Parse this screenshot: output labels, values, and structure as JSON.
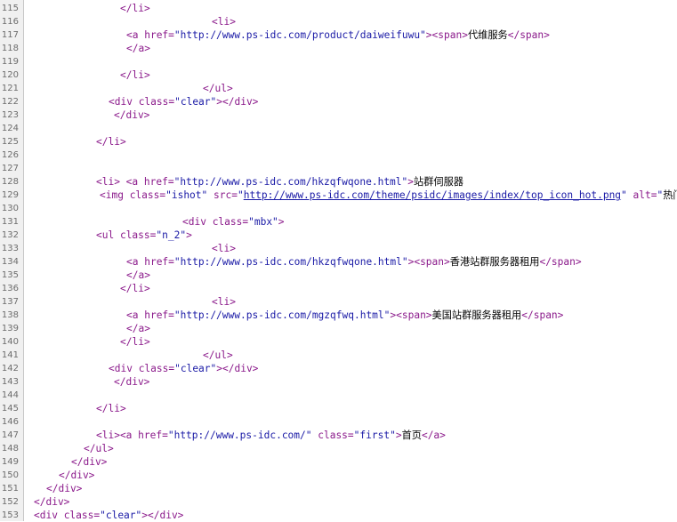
{
  "lines": [
    {
      "num": "115",
      "segs": [
        {
          "t": "t",
          "s": "</li>"
        }
      ]
    },
    {
      "num": "116",
      "segs": [
        {
          "t": "t",
          "s": "<li>"
        }
      ]
    },
    {
      "num": "117",
      "segs": [
        {
          "t": "t",
          "s": "<a "
        },
        {
          "t": "a",
          "s": "href="
        },
        {
          "t": "v",
          "s": "\"http://www.ps-idc.com/product/daiweifuwu\""
        },
        {
          "t": "t",
          "s": "><span>"
        },
        {
          "t": "c",
          "s": "代维服务"
        },
        {
          "t": "t",
          "s": "</span>"
        }
      ]
    },
    {
      "num": "118",
      "segs": [
        {
          "t": "t",
          "s": "</a>"
        }
      ]
    },
    {
      "num": "119",
      "segs": []
    },
    {
      "num": "120",
      "segs": [
        {
          "t": "t",
          "s": "</li>"
        }
      ]
    },
    {
      "num": "121",
      "segs": [
        {
          "t": "t",
          "s": "</ul>"
        }
      ]
    },
    {
      "num": "122",
      "segs": [
        {
          "t": "t",
          "s": "<div "
        },
        {
          "t": "a",
          "s": "class="
        },
        {
          "t": "v",
          "s": "\"clear\""
        },
        {
          "t": "t",
          "s": "></div>"
        }
      ]
    },
    {
      "num": "123",
      "segs": [
        {
          "t": "t",
          "s": "</div>"
        }
      ]
    },
    {
      "num": "124",
      "segs": []
    },
    {
      "num": "125",
      "segs": [
        {
          "t": "t",
          "s": "</li>"
        }
      ]
    },
    {
      "num": "126",
      "segs": []
    },
    {
      "num": "127",
      "segs": []
    },
    {
      "num": "128",
      "segs": [
        {
          "t": "t",
          "s": "<li> <a "
        },
        {
          "t": "a",
          "s": "href="
        },
        {
          "t": "v",
          "s": "\"http://www.ps-idc.com/hkzqfwqone.html\""
        },
        {
          "t": "t",
          "s": ">"
        },
        {
          "t": "c",
          "s": "站群伺服器"
        }
      ]
    },
    {
      "num": "129",
      "segs": [
        {
          "t": "t",
          "s": "<img "
        },
        {
          "t": "a",
          "s": "class="
        },
        {
          "t": "v",
          "s": "\"ishot\" "
        },
        {
          "t": "a",
          "s": "src="
        },
        {
          "t": "v",
          "s": "\""
        },
        {
          "t": "u",
          "s": "http://www.ps-idc.com/theme/psidc/images/index/top_icon_hot.png"
        },
        {
          "t": "v",
          "s": "\" "
        },
        {
          "t": "a",
          "s": "alt="
        },
        {
          "t": "v",
          "s": "\""
        },
        {
          "t": "c",
          "s": "热门"
        },
        {
          "t": "v",
          "s": "\""
        }
      ]
    },
    {
      "num": "130",
      "segs": []
    },
    {
      "num": "131",
      "segs": [
        {
          "t": "t",
          "s": "<div "
        },
        {
          "t": "a",
          "s": "class="
        },
        {
          "t": "v",
          "s": "\"mbx\""
        },
        {
          "t": "t",
          "s": ">"
        }
      ]
    },
    {
      "num": "132",
      "segs": [
        {
          "t": "t",
          "s": "<ul "
        },
        {
          "t": "a",
          "s": "class="
        },
        {
          "t": "v",
          "s": "\"n_2\""
        },
        {
          "t": "t",
          "s": ">"
        }
      ]
    },
    {
      "num": "133",
      "segs": [
        {
          "t": "t",
          "s": "<li>"
        }
      ]
    },
    {
      "num": "134",
      "segs": [
        {
          "t": "t",
          "s": "<a "
        },
        {
          "t": "a",
          "s": "href="
        },
        {
          "t": "v",
          "s": "\"http://www.ps-idc.com/hkzqfwqone.html\""
        },
        {
          "t": "t",
          "s": "><span>"
        },
        {
          "t": "c",
          "s": "香港站群服务器租用"
        },
        {
          "t": "t",
          "s": "</span>"
        }
      ]
    },
    {
      "num": "135",
      "segs": [
        {
          "t": "t",
          "s": "</a>"
        }
      ]
    },
    {
      "num": "136",
      "segs": [
        {
          "t": "t",
          "s": "</li>"
        }
      ]
    },
    {
      "num": "137",
      "segs": [
        {
          "t": "t",
          "s": "<li>"
        }
      ]
    },
    {
      "num": "138",
      "segs": [
        {
          "t": "t",
          "s": "<a "
        },
        {
          "t": "a",
          "s": "href="
        },
        {
          "t": "v",
          "s": "\"http://www.ps-idc.com/mgzqfwq.html\""
        },
        {
          "t": "t",
          "s": "><span>"
        },
        {
          "t": "c",
          "s": "美国站群服务器租用"
        },
        {
          "t": "t",
          "s": "</span>"
        }
      ]
    },
    {
      "num": "139",
      "segs": [
        {
          "t": "t",
          "s": "</a>"
        }
      ]
    },
    {
      "num": "140",
      "segs": [
        {
          "t": "t",
          "s": "</li>"
        }
      ]
    },
    {
      "num": "141",
      "segs": [
        {
          "t": "t",
          "s": "</ul>"
        }
      ]
    },
    {
      "num": "142",
      "segs": [
        {
          "t": "t",
          "s": "<div "
        },
        {
          "t": "a",
          "s": "class="
        },
        {
          "t": "v",
          "s": "\"clear\""
        },
        {
          "t": "t",
          "s": "></div>"
        }
      ]
    },
    {
      "num": "143",
      "segs": [
        {
          "t": "t",
          "s": "</div>"
        }
      ]
    },
    {
      "num": "144",
      "segs": []
    },
    {
      "num": "145",
      "segs": [
        {
          "t": "t",
          "s": "</li>"
        }
      ]
    },
    {
      "num": "146",
      "segs": []
    },
    {
      "num": "147",
      "segs": [
        {
          "t": "t",
          "s": "<li><a "
        },
        {
          "t": "a",
          "s": "href="
        },
        {
          "t": "v",
          "s": "\"http://www.ps-idc.com/\" "
        },
        {
          "t": "a",
          "s": "class="
        },
        {
          "t": "v",
          "s": "\"first\""
        },
        {
          "t": "t",
          "s": ">"
        },
        {
          "t": "c",
          "s": "首页"
        },
        {
          "t": "t",
          "s": "</a>"
        }
      ]
    },
    {
      "num": "148",
      "segs": [
        {
          "t": "t",
          "s": "</ul>"
        }
      ]
    },
    {
      "num": "149",
      "segs": [
        {
          "t": "t",
          "s": "</div>"
        }
      ]
    },
    {
      "num": "150",
      "segs": [
        {
          "t": "t",
          "s": "</div>"
        }
      ]
    },
    {
      "num": "151",
      "segs": [
        {
          "t": "t",
          "s": "</div>"
        }
      ]
    },
    {
      "num": "152",
      "segs": [
        {
          "t": "t",
          "s": "</div>"
        }
      ]
    },
    {
      "num": "153",
      "segs": [
        {
          "t": "t",
          "s": "<div "
        },
        {
          "t": "a",
          "s": "class="
        },
        {
          "t": "v",
          "s": "\"clear\""
        },
        {
          "t": "t",
          "s": "></div>"
        }
      ]
    }
  ]
}
